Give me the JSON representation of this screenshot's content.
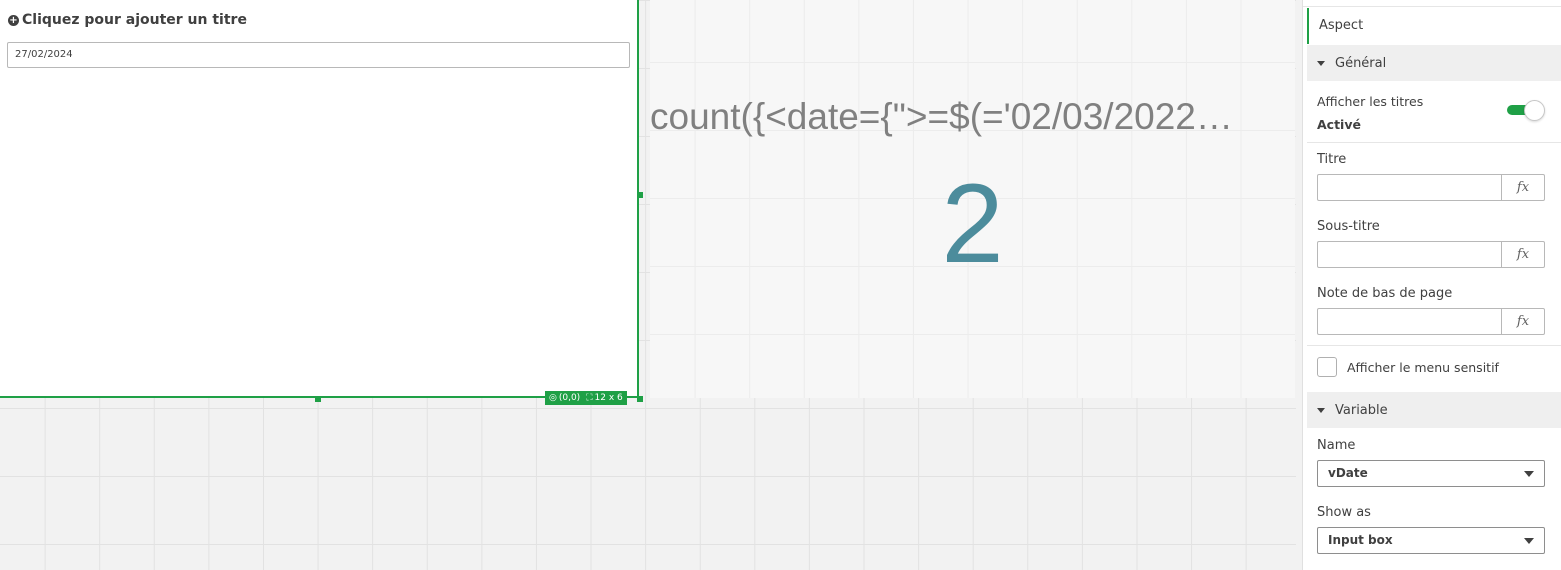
{
  "left_object": {
    "add_title_label": "Cliquez pour ajouter un titre",
    "date_value": "27/02/2024",
    "position_badge": "(0,0)",
    "size_badge": "12 x 6"
  },
  "kpi": {
    "title": "count({<date={\">=$(='02/03/2022…",
    "value": "2",
    "value_color": "#4c8c9c"
  },
  "panel": {
    "tab_label": "Aspect",
    "general": {
      "header": "Général",
      "show_titles_label": "Afficher les titres",
      "show_titles_state": "Activé",
      "title_label": "Titre",
      "subtitle_label": "Sous-titre",
      "footnote_label": "Note de bas de page",
      "fx_label": "fx",
      "hover_menu_label": "Afficher le menu sensitif"
    },
    "variable": {
      "header": "Variable",
      "name_label": "Name",
      "name_value": "vDate",
      "show_as_label": "Show as",
      "show_as_value": "Input box"
    }
  },
  "colors": {
    "accent": "#1fa046",
    "text": "#404040"
  }
}
